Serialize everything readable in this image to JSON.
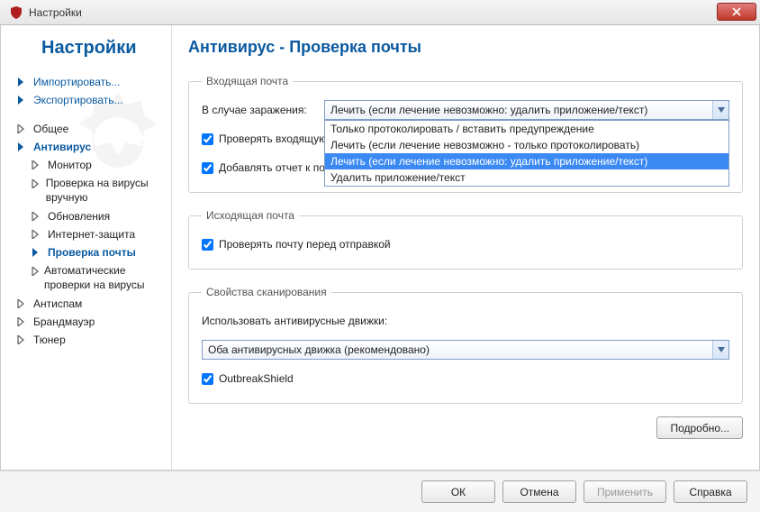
{
  "window": {
    "title": "Настройки"
  },
  "sidebar": {
    "header": "Настройки",
    "import": "Импортировать...",
    "export": "Экспортировать...",
    "items": [
      {
        "label": "Общее"
      },
      {
        "label": "Антивирус"
      },
      {
        "label": "Монитор"
      },
      {
        "label": "Проверка на вирусы вручную"
      },
      {
        "label": "Обновления"
      },
      {
        "label": "Интернет-защита"
      },
      {
        "label": "Проверка почты"
      },
      {
        "label": "Автоматические проверки на вирусы"
      },
      {
        "label": "Антиспам"
      },
      {
        "label": "Брандмауэр"
      },
      {
        "label": "Тюнер"
      }
    ]
  },
  "page": {
    "title": "Антивирус - Проверка почты"
  },
  "incoming": {
    "legend": "Входящая почта",
    "on_infection_label": "В случае заражения:",
    "on_infection_value": "Лечить (если лечение невозможно: удалить приложение/текст)",
    "options": [
      "Только протоколировать / вставить предупреждение",
      "Лечить (если лечение невозможно - только протоколировать)",
      "Лечить (если лечение невозможно: удалить приложение/текст)",
      "Удалить приложение/текст"
    ],
    "check_incoming": "Проверять входящую",
    "add_report": "Добавлять отчет к по"
  },
  "outgoing": {
    "legend": "Исходящая почта",
    "check_before_send": "Проверять почту перед отправкой"
  },
  "scan": {
    "legend": "Свойства сканирования",
    "engine_label": "Использовать антивирусные движки:",
    "engine_value": "Оба антивирусных движка (рекомендовано)",
    "outbreak": "OutbreakShield",
    "details_btn": "Подробно..."
  },
  "footer": {
    "ok": "ОК",
    "cancel": "Отмена",
    "apply": "Применить",
    "help": "Справка"
  }
}
